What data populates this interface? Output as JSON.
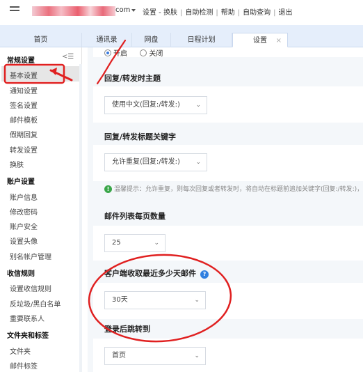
{
  "header": {
    "email_suffix": "com",
    "nav_links": [
      "设置 - 换肤",
      "自助检测",
      "帮助",
      "自助查询",
      "退出"
    ]
  },
  "tabs": [
    {
      "label": "首页"
    },
    {
      "label": "通讯录"
    },
    {
      "label": "网盘"
    },
    {
      "label": "日程计划"
    },
    {
      "label": "设置",
      "active": true,
      "close": "×"
    }
  ],
  "sidebar": {
    "groups": [
      {
        "title": "常规设置",
        "items": [
          "基本设置",
          "通知设置",
          "签名设置",
          "邮件模板",
          "假期回复",
          "转发设置",
          "换肤"
        ]
      },
      {
        "title": "账户设置",
        "items": [
          "账户信息",
          "修改密码",
          "账户安全",
          "设置头像",
          "别名帐户管理"
        ]
      },
      {
        "title": "收信规则",
        "items": [
          "设置收信规则",
          "反垃圾/黑白名单",
          "重要联系人"
        ]
      },
      {
        "title": "文件夹和标签",
        "items": [
          "文件夹",
          "邮件标签"
        ]
      }
    ],
    "active_item": "基本设置",
    "collapse_icon": "collapse-menu-icon"
  },
  "settings": {
    "radio_on_label": "开启",
    "radio_off_label": "关闭",
    "sections": [
      {
        "title": "回复/转发时主题",
        "select_value": "使用中文(回复:/转发:)"
      },
      {
        "title": "回复/转发标题关键字",
        "select_value": "允许重复(回复:/转发:)",
        "hint": "温馨提示：允许重复，则每次回复或者转发时，将自动在标题前追加关键字(回复:/转发:)，内容保持不变"
      },
      {
        "title": "邮件列表每页数量",
        "select_value": "25"
      },
      {
        "title": "客户端收取最近多少天邮件",
        "select_value": "30天",
        "help_icon": "?"
      },
      {
        "title": "登录后跳转到",
        "select_value": "首页"
      }
    ]
  },
  "colors": {
    "accent_blue": "#2f7fe0",
    "annotation_red": "#e02020",
    "hint_green": "#3aa649",
    "tab_bar": "#e5eefb"
  }
}
